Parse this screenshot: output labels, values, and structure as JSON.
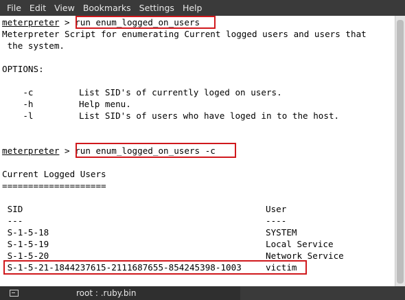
{
  "menubar": {
    "items": [
      "File",
      "Edit",
      "View",
      "Bookmarks",
      "Settings",
      "Help"
    ]
  },
  "terminal": {
    "prompt1": {
      "word": "meterpreter",
      "symbol": " > ",
      "command": "run enum_logged_on_users"
    },
    "description_line1": "Meterpreter Script for enumerating Current logged users and users that",
    "description_line2": " the system.",
    "options_header": "OPTIONS:",
    "options": [
      {
        "flag": "    -c",
        "text": "List SID's of currently loged on users."
      },
      {
        "flag": "    -h",
        "text": "Help menu."
      },
      {
        "flag": "    -l",
        "text": "List SID's of users who have loged in to the host."
      }
    ],
    "prompt2": {
      "word": "meterpreter",
      "symbol": " > ",
      "command": "run enum_logged_on_users -c"
    },
    "section_title": "Current Logged Users",
    "section_rule": "====================",
    "table": {
      "headers": {
        "sid": " SID",
        "user": "User"
      },
      "separators": {
        "sid": " ---",
        "user": "----"
      },
      "rows": [
        {
          "sid": " S-1-5-18",
          "user": "SYSTEM"
        },
        {
          "sid": " S-1-5-19",
          "user": "Local Service"
        },
        {
          "sid": " S-1-5-20",
          "user": "Network Service"
        },
        {
          "sid": " S-1-5-21-1844237615-2111687655-854245398-1003",
          "user": "victim"
        }
      ]
    },
    "highlight_color": "#d0181c"
  },
  "tabbar": {
    "icon": "terminal-icon",
    "title": "root : .ruby.bin"
  }
}
